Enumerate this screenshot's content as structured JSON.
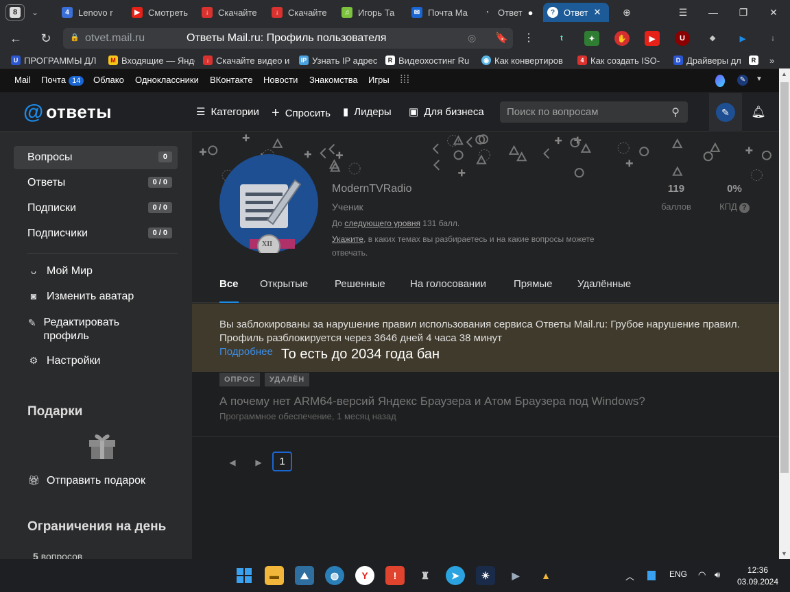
{
  "browser": {
    "tab_count": "8",
    "tabs": [
      {
        "title": "Lenovo r",
        "icon": "lenovo-icon"
      },
      {
        "title": "Смотреть",
        "icon": "youtube-icon"
      },
      {
        "title": "Скачайте",
        "icon": "download-icon"
      },
      {
        "title": "Скачайте",
        "icon": "download-icon"
      },
      {
        "title": "Игорь Та",
        "icon": "music-icon"
      },
      {
        "title": "Почта Ма",
        "icon": "mail-icon"
      },
      {
        "title": "Ответ",
        "icon": "loading-icon"
      },
      {
        "title": "Ответ",
        "icon": "otvety-icon"
      }
    ],
    "url_domain": "otvet.mail.ru",
    "page_title": "Ответы Mail.ru: Профиль пользователя",
    "bookmarks": [
      "ПРОГРАММЫ ДЛ",
      "Входящие — Янде",
      "Скачайте видео и",
      "Узнать IP адрес",
      "Видеохостинг Ru",
      "Как конвертиров",
      "Как создать ISO-",
      "Драйверы дл"
    ]
  },
  "portal": {
    "links": [
      "Mail",
      "Почта",
      "Облако",
      "Одноклассники",
      "ВКонтакте",
      "Новости",
      "Знакомства",
      "Игры"
    ],
    "mail_badge": "14"
  },
  "header": {
    "logo_text": "ответы",
    "nav": [
      "Категории",
      "Спросить",
      "Лидеры",
      "Для бизнеса"
    ],
    "search_placeholder": "Поиск по вопросам"
  },
  "sidebar": {
    "counters": [
      {
        "label": "Вопросы",
        "count": "0"
      },
      {
        "label": "Ответы",
        "count": "0 / 0"
      },
      {
        "label": "Подписки",
        "count": "0 / 0"
      },
      {
        "label": "Подписчики",
        "count": "0 / 0"
      }
    ],
    "links": [
      "Мой Мир",
      "Изменить аватар",
      "Редактировать профиль",
      "Настройки"
    ],
    "gifts_title": "Подарки",
    "send_gift": "Отправить подарок",
    "limits_title": "Ограничения на день",
    "limits_first": "5",
    "limits_first_label": "вопросов"
  },
  "profile": {
    "avatar_badge": "XII",
    "username": "ModernTVRadio",
    "rank": "Ученик",
    "next_level_prefix": "До",
    "next_level_link": "следующего уровня",
    "next_level_suffix": "131 балл.",
    "hint_link": "Укажите",
    "hint_text": ", в каких темах вы разбираетесь и на какие вопросы можете отвечать.",
    "points_value": "119",
    "points_label": "баллов",
    "kpd_value": "0%",
    "kpd_label": "КПД"
  },
  "filter_tabs": [
    "Все",
    "Открытые",
    "Решенные",
    "На голосовании",
    "Прямые",
    "Удалённые"
  ],
  "ban": {
    "line1": "Вы заблокированы за нарушение правил использования сервиса Ответы Mail.ru: Грубое нарушение правил.",
    "line2": "Профиль разблокируется через 3646 дней 4 часа 38 минут",
    "more": "Подробнее",
    "note": "То есть до 2034 года бан"
  },
  "question": {
    "tags": [
      "ОПРОС",
      "УДАЛЁН"
    ],
    "title": "А почему нет ARM64-версий Яндекс Браузера и Атом Браузера под Windows?",
    "meta": "Программное обеспечение, 1 месяц назад"
  },
  "pagination": {
    "current": "1"
  },
  "taskbar": {
    "lang": "ENG",
    "time": "12:36",
    "date": "03.09.2024"
  }
}
